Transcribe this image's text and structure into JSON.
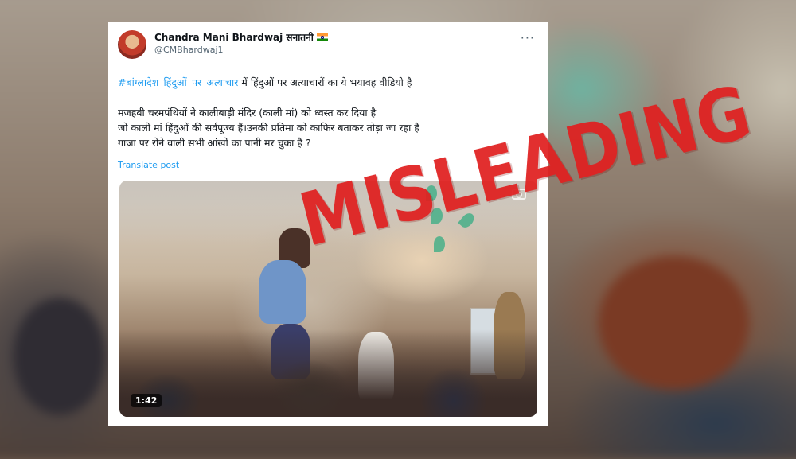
{
  "tweet": {
    "author_name": "Chandra Mani Bhardwaj सनातनी",
    "author_handle": "@CMBhardwaj1",
    "more_label": "···",
    "hashtag": "#बांग्लादेश_हिंदुओं_पर_अत्याचार",
    "line1_rest": " में हिंदुओं पर अत्याचारों का ये भयावह वीडियो है",
    "line2": "मजहबी चरमपंथियों ने कालीबाड़ी मंदिर (काली मां) को ध्वस्त कर दिया है",
    "line3": "जो काली मां हिंदुओं की  सर्वपूज्य हैं।उनकी प्रतिमा को काफिर बताकर तोड़ा जा रहा है",
    "line4": "गाजा पर रोने वाली सभी आंखों का पानी मर चुका है ?",
    "translate_label": "Translate post"
  },
  "video": {
    "duration": "1:42"
  },
  "stamp": {
    "text": "MISLEADING",
    "color": "#e02020"
  },
  "icons": {
    "flag": "india-flag-icon",
    "more": "more-options-icon",
    "camera": "camera-icon"
  }
}
